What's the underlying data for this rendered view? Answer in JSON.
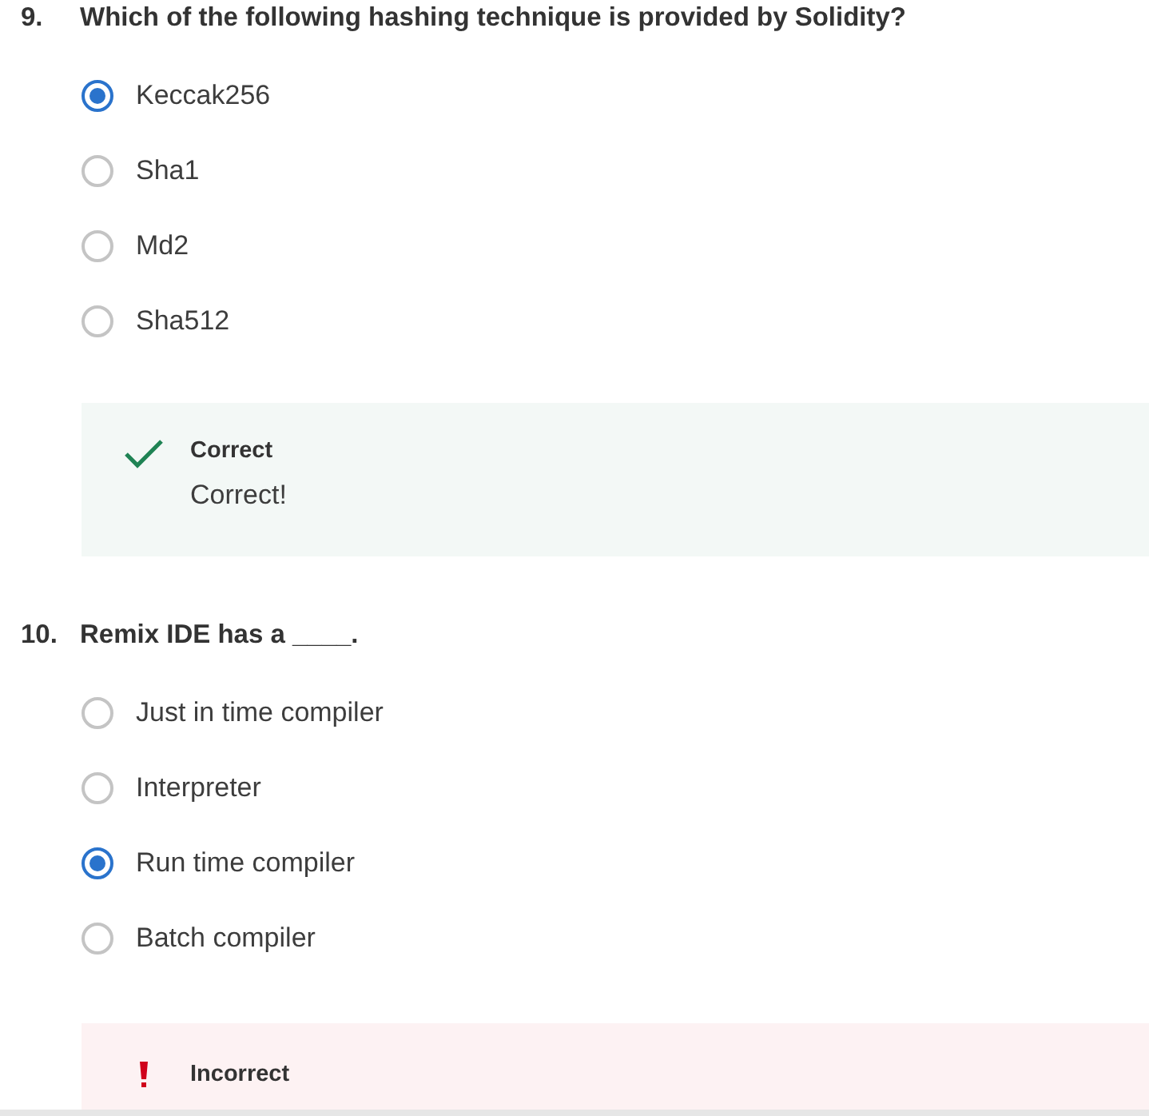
{
  "questions": [
    {
      "number": "9.",
      "text": "Which of the following hashing technique is provided by Solidity?",
      "options": [
        {
          "label": "Keccak256",
          "selected": true
        },
        {
          "label": "Sha1",
          "selected": false
        },
        {
          "label": "Md2",
          "selected": false
        },
        {
          "label": "Sha512",
          "selected": false
        }
      ],
      "feedback": {
        "kind": "correct",
        "title": "Correct",
        "message": "Correct!"
      }
    },
    {
      "number": "10.",
      "text": "Remix IDE has a ____.",
      "options": [
        {
          "label": "Just in time compiler",
          "selected": false
        },
        {
          "label": "Interpreter",
          "selected": false
        },
        {
          "label": "Run time compiler",
          "selected": true
        },
        {
          "label": "Batch compiler",
          "selected": false
        }
      ],
      "feedback": {
        "kind": "incorrect",
        "title": "Incorrect"
      }
    }
  ]
}
